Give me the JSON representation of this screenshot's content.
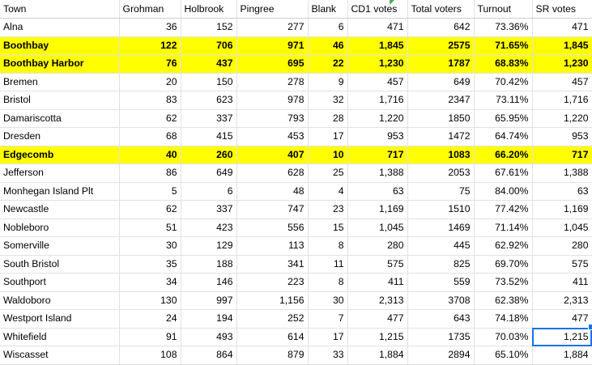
{
  "columns": [
    "Town",
    "Grohman",
    "Holbrook",
    "Pingree",
    "Blank",
    "CD1 votes",
    "Total voters",
    "Turnout",
    "SR votes"
  ],
  "rows": [
    {
      "cells": [
        "Alna",
        "36",
        "152",
        "277",
        "6",
        "471",
        "642",
        "73.36%",
        "471"
      ],
      "highlight": false
    },
    {
      "cells": [
        "Boothbay",
        "122",
        "706",
        "971",
        "46",
        "1,845",
        "2575",
        "71.65%",
        "1,845"
      ],
      "highlight": true
    },
    {
      "cells": [
        "Boothbay Harbor",
        "76",
        "437",
        "695",
        "22",
        "1,230",
        "1787",
        "68.83%",
        "1,230"
      ],
      "highlight": true
    },
    {
      "cells": [
        "Bremen",
        "20",
        "150",
        "278",
        "9",
        "457",
        "649",
        "70.42%",
        "457"
      ],
      "highlight": false
    },
    {
      "cells": [
        "Bristol",
        "83",
        "623",
        "978",
        "32",
        "1,716",
        "2347",
        "73.11%",
        "1,716"
      ],
      "highlight": false
    },
    {
      "cells": [
        "Damariscotta",
        "62",
        "337",
        "793",
        "28",
        "1,220",
        "1850",
        "65.95%",
        "1,220"
      ],
      "highlight": false
    },
    {
      "cells": [
        "Dresden",
        "68",
        "415",
        "453",
        "17",
        "953",
        "1472",
        "64.74%",
        "953"
      ],
      "highlight": false
    },
    {
      "cells": [
        "Edgecomb",
        "40",
        "260",
        "407",
        "10",
        "717",
        "1083",
        "66.20%",
        "717"
      ],
      "highlight": true
    },
    {
      "cells": [
        "Jefferson",
        "86",
        "649",
        "628",
        "25",
        "1,388",
        "2053",
        "67.61%",
        "1,388"
      ],
      "highlight": false
    },
    {
      "cells": [
        "Monhegan Island Plt",
        "5",
        "6",
        "48",
        "4",
        "63",
        "75",
        "84.00%",
        "63"
      ],
      "highlight": false
    },
    {
      "cells": [
        "Newcastle",
        "62",
        "337",
        "747",
        "23",
        "1,169",
        "1510",
        "77.42%",
        "1,169"
      ],
      "highlight": false
    },
    {
      "cells": [
        "Nobleboro",
        "51",
        "423",
        "556",
        "15",
        "1,045",
        "1469",
        "71.14%",
        "1,045"
      ],
      "highlight": false
    },
    {
      "cells": [
        "Somerville",
        "30",
        "129",
        "113",
        "8",
        "280",
        "445",
        "62.92%",
        "280"
      ],
      "highlight": false
    },
    {
      "cells": [
        "South Bristol",
        "35",
        "188",
        "341",
        "11",
        "575",
        "825",
        "69.70%",
        "575"
      ],
      "highlight": false
    },
    {
      "cells": [
        "Southport",
        "34",
        "146",
        "223",
        "8",
        "411",
        "559",
        "73.52%",
        "411"
      ],
      "highlight": false
    },
    {
      "cells": [
        "Waldoboro",
        "130",
        "997",
        "1,156",
        "30",
        "2,313",
        "3708",
        "62.38%",
        "2,313"
      ],
      "highlight": false
    },
    {
      "cells": [
        "Westport Island",
        "24",
        "194",
        "252",
        "7",
        "477",
        "643",
        "74.18%",
        "477"
      ],
      "highlight": false
    },
    {
      "cells": [
        "Whitefield",
        "91",
        "493",
        "614",
        "17",
        "1,215",
        "1735",
        "70.03%",
        "1,215"
      ],
      "highlight": false
    },
    {
      "cells": [
        "Wiscasset",
        "108",
        "864",
        "879",
        "33",
        "1,884",
        "2894",
        "65.10%",
        "1,884"
      ],
      "highlight": false
    }
  ],
  "selected_cell": {
    "row": 17,
    "col": 8
  },
  "colors": {
    "highlight": "#ffff00",
    "selection": "#1a73e8",
    "grid": "#e2e2e2"
  }
}
